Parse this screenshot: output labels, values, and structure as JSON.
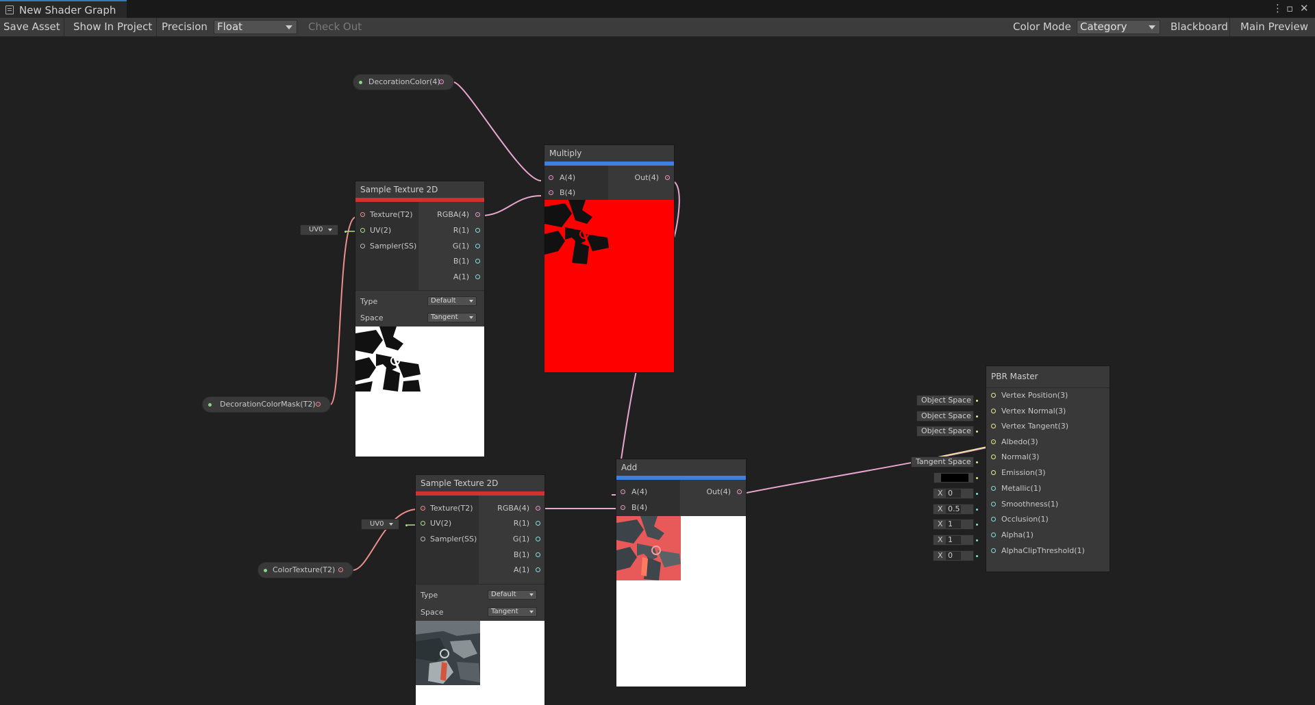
{
  "window": {
    "tab_title": "New Shader Graph",
    "controls": [
      "more-icon",
      "maximize-icon",
      "close-icon"
    ]
  },
  "toolbar": {
    "save_asset": "Save Asset",
    "show_in_project": "Show In Project",
    "precision_label": "Precision",
    "precision_value": "Float",
    "check_out": "Check Out",
    "color_mode_label": "Color Mode",
    "color_mode_value": "Category",
    "blackboard": "Blackboard",
    "main_preview": "Main Preview"
  },
  "properties": {
    "decoration_color": "DecorationColor(4)",
    "decoration_color_mask": "DecorationColorMask(T2)",
    "color_texture": "ColorTexture(T2)"
  },
  "sample_texture_1": {
    "title": "Sample Texture 2D",
    "inputs": [
      "Texture(T2)",
      "UV(2)",
      "Sampler(SS)"
    ],
    "outputs": [
      "RGBA(4)",
      "R(1)",
      "G(1)",
      "B(1)",
      "A(1)"
    ],
    "uv_default": "UV0",
    "type_label": "Type",
    "type_value": "Default",
    "space_label": "Space",
    "space_value": "Tangent"
  },
  "sample_texture_2": {
    "title": "Sample Texture 2D",
    "inputs": [
      "Texture(T2)",
      "UV(2)",
      "Sampler(SS)"
    ],
    "outputs": [
      "RGBA(4)",
      "R(1)",
      "G(1)",
      "B(1)",
      "A(1)"
    ],
    "uv_default": "UV0",
    "type_label": "Type",
    "type_value": "Default",
    "space_label": "Space",
    "space_value": "Tangent"
  },
  "multiply": {
    "title": "Multiply",
    "inputs": [
      "A(4)",
      "B(4)"
    ],
    "output": "Out(4)"
  },
  "add": {
    "title": "Add",
    "inputs": [
      "A(4)",
      "B(4)"
    ],
    "output": "Out(4)"
  },
  "pbr_master": {
    "title": "PBR Master",
    "inputs": [
      "Vertex Position(3)",
      "Vertex Normal(3)",
      "Vertex Tangent(3)",
      "Albedo(3)",
      "Normal(3)",
      "Emission(3)",
      "Metallic(1)",
      "Smoothness(1)",
      "Occlusion(1)",
      "Alpha(1)",
      "AlphaClipThreshold(1)"
    ],
    "object_space": "Object Space",
    "tangent_space": "Tangent Space",
    "x_label": "X",
    "metallic": "0",
    "smoothness": "0.5",
    "occlusion": "1",
    "alpha": "1",
    "alpha_clip": "0",
    "emission_color": "#000000"
  },
  "colors": {
    "multiply_bar": "#3f7fe0",
    "add_bar": "#3f7fe0",
    "sample_bar": "#d33030",
    "wire_vector4": "#e9a6cf",
    "wire_vector3": "#eeee9a",
    "wire_texture": "#ee8e8e"
  }
}
